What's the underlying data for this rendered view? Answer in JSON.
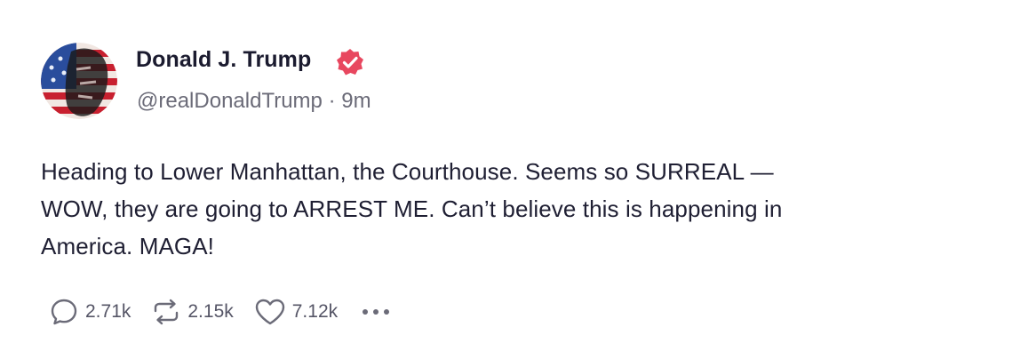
{
  "post": {
    "author": {
      "display_name": "Donald J. Trump",
      "handle": "@realDonaldTrump",
      "separator": "·",
      "time": "9m",
      "verified": true,
      "verified_color": "#e8475f",
      "avatar_icon": "flag-portrait-avatar"
    },
    "lines": [
      "Heading to Lower Manhattan, the Courthouse. Seems so SURREAL —",
      "WOW, they are going to ARREST ME. Can’t believe this is happening in",
      "America. MAGA!"
    ],
    "actions": {
      "replies": {
        "icon": "reply-icon",
        "count": "2.71k"
      },
      "retruths": {
        "icon": "retruth-icon",
        "count": "2.15k"
      },
      "likes": {
        "icon": "heart-icon",
        "count": "7.12k"
      },
      "more": {
        "icon": "more-dots-icon"
      }
    }
  }
}
